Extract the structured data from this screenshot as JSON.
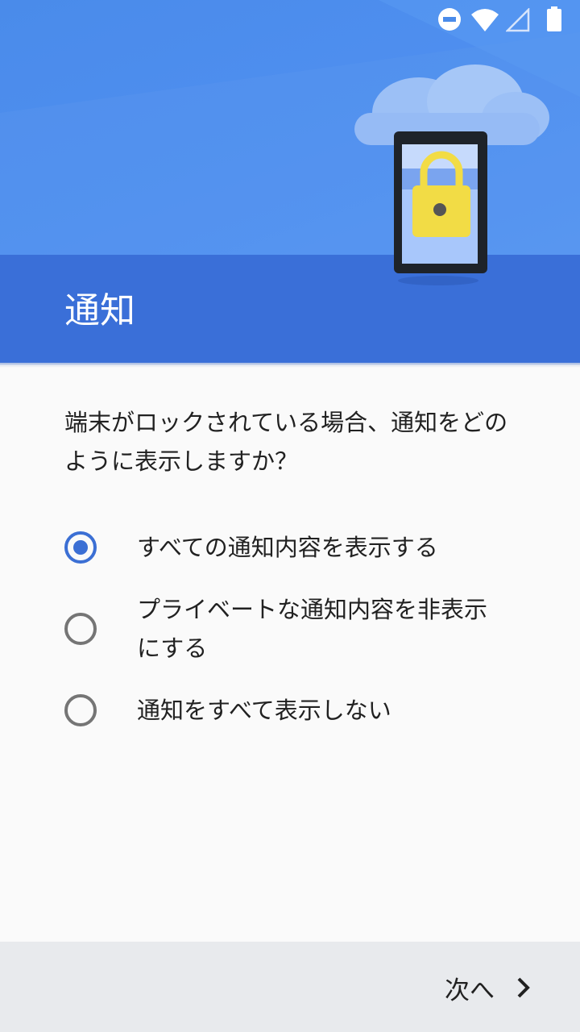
{
  "status_bar": {
    "icons": [
      "do-not-disturb-icon",
      "wifi-icon",
      "cellular-signal-icon",
      "battery-icon"
    ]
  },
  "header": {
    "title": "通知",
    "illustration": "phone-lock-illustration"
  },
  "content": {
    "question": "端末がロックされている場合、通知をどのように表示しますか？",
    "options": [
      {
        "label": "すべての通知内容を表示する",
        "selected": true
      },
      {
        "label": "プライベートな通知内容を非表示にする",
        "selected": false
      },
      {
        "label": "通知をすべて表示しない",
        "selected": false
      }
    ]
  },
  "footer": {
    "next_label": "次へ",
    "next_icon": "chevron-right-icon"
  },
  "colors": {
    "accent": "#3b6fd4",
    "header_band": "#3a6fd8",
    "header_sky": "#4f8ff0",
    "lock_yellow": "#f2dc45"
  }
}
